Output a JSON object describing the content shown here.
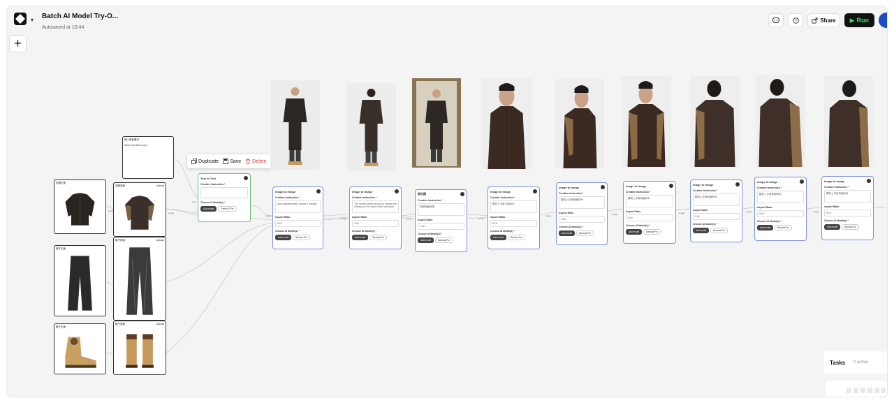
{
  "header": {
    "project_title": "Batch AI Model Try-O...",
    "autosave": "Autosaved at 10:44",
    "share_label": "Share",
    "run_label": "Run"
  },
  "context_menu": {
    "duplicate": "Duplicate",
    "save": "Save",
    "delete": "Delete"
  },
  "tasks": {
    "label": "Tasks",
    "status": "0 active"
  },
  "prompt_card": {
    "title": "输入角色要求",
    "text": "Asian handsome guy"
  },
  "text_node": {
    "title": "Text to Text",
    "instruction_label": "Creative Instruction *",
    "model_label": "Choose AI Model(s) *",
    "add_label": "Add model",
    "model_chip": "Gemini 2 Pro"
  },
  "input_cards": [
    {
      "title": "衣服正面",
      "upload": ""
    },
    {
      "title": "衣服背面",
      "upload": "Upload"
    },
    {
      "title": "裤子正面",
      "upload": ""
    },
    {
      "title": "裤子背面",
      "upload": "Upload"
    },
    {
      "title": "鞋子正面",
      "upload": ""
    },
    {
      "title": "鞋子背面",
      "upload": "Upload"
    }
  ],
  "image_nodes": [
    {
      "title": "Image to Image",
      "instr": "Add supplementary details if needed",
      "ratio": "9:16"
    },
    {
      "title": "Image to Image",
      "instr": "The model turned around to display the clothing on the back of the new input.",
      "ratio": "9:16"
    },
    {
      "title": "侧位图",
      "instr": "拍摄侧面效果",
      "ratio": "9:16"
    },
    {
      "title": "Image to Image",
      "instr": "模特上半身正面特写",
      "ratio": "9:16"
    },
    {
      "title": "Image to Image",
      "instr": "模特上半身侧面特写",
      "ratio": "9:16"
    },
    {
      "title": "Image to Image",
      "instr": "模特上半身侧面特写",
      "ratio": "9:16"
    },
    {
      "title": "Image to Image",
      "instr": "模特上半身背面特写",
      "ratio": "9:16"
    },
    {
      "title": "Image to Image",
      "instr": "模特上半身背面特写",
      "ratio": "9:16"
    },
    {
      "title": "Image to Image",
      "instr": "模特上半身背面特写",
      "ratio": "9:16"
    }
  ],
  "node_common": {
    "instruction_label": "Creative Instruction *",
    "ratio_label": "Aspect Ratio",
    "model_label": "Choose AI Model(s) *",
    "add_label": "Add model",
    "model_chip": "Banana Pro",
    "ports": {
      "image": "image",
      "text": "text"
    }
  }
}
